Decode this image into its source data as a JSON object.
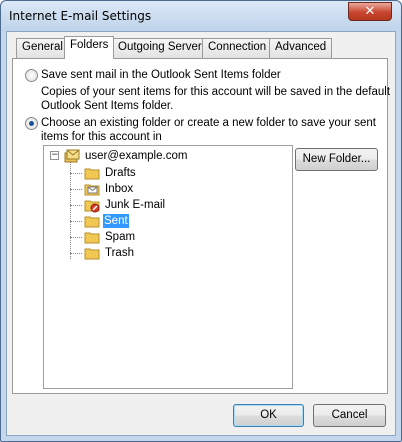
{
  "window": {
    "title": "Internet E-mail Settings",
    "close_glyph": "✕"
  },
  "tabs": [
    {
      "label": "General",
      "active": false
    },
    {
      "label": "Folders",
      "active": true
    },
    {
      "label": "Outgoing Server",
      "active": false
    },
    {
      "label": "Connection",
      "active": false
    },
    {
      "label": "Advanced",
      "active": false
    }
  ],
  "options": {
    "save_sent_label": "Save sent mail in the Outlook Sent Items folder",
    "save_sent_checked": false,
    "save_sent_desc_line1": "Copies of your sent items for this account will be saved in the default",
    "save_sent_desc_line2": "Outlook Sent Items folder.",
    "choose_folder_label_line1": "Choose an existing folder or create a new folder to save your sent",
    "choose_folder_label_line2": "items for this account in",
    "choose_folder_checked": true
  },
  "tree": {
    "root_label": "user@example.com",
    "root_expander": "−",
    "folders": [
      {
        "label": "Drafts",
        "icon": "folder-icon"
      },
      {
        "label": "Inbox",
        "icon": "inbox-icon"
      },
      {
        "label": "Junk E-mail",
        "icon": "junk-folder-icon"
      },
      {
        "label": "Sent",
        "icon": "folder-icon",
        "selected": true
      },
      {
        "label": "Spam",
        "icon": "folder-icon"
      },
      {
        "label": "Trash",
        "icon": "folder-icon"
      }
    ]
  },
  "buttons": {
    "new_folder": "New Folder...",
    "ok": "OK",
    "cancel": "Cancel"
  },
  "colors": {
    "selection": "#3399ff",
    "window_frame": "#c4d6ec",
    "close_button": "#c8462f"
  }
}
